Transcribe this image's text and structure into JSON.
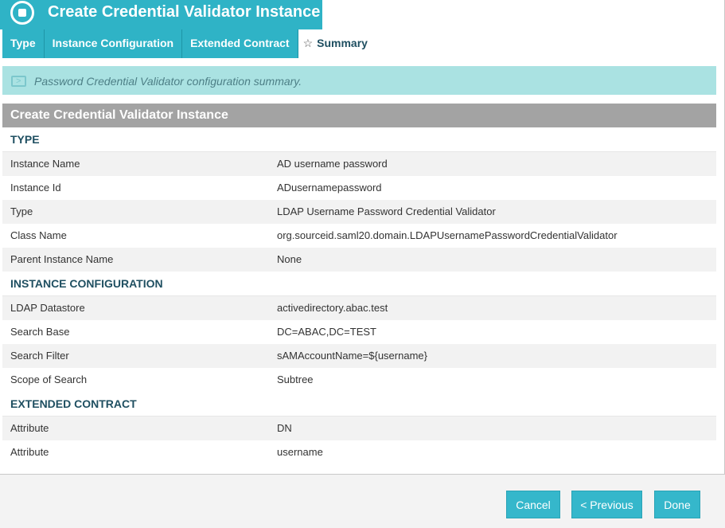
{
  "header": {
    "title": "Create Credential Validator Instance"
  },
  "tabs": [
    {
      "label": "Type"
    },
    {
      "label": "Instance Configuration"
    },
    {
      "label": "Extended Contract"
    },
    {
      "label": "Summary"
    }
  ],
  "info": {
    "text": "Password Credential Validator configuration summary."
  },
  "summary": {
    "title": "Create Credential Validator Instance",
    "type": {
      "title": "TYPE",
      "rows": [
        {
          "label": "Instance Name",
          "value": "AD username password"
        },
        {
          "label": "Instance Id",
          "value": "ADusernamepassword"
        },
        {
          "label": "Type",
          "value": "LDAP Username Password Credential Validator"
        },
        {
          "label": "Class Name",
          "value": "org.sourceid.saml20.domain.LDAPUsernamePasswordCredentialValidator"
        },
        {
          "label": "Parent Instance Name",
          "value": "None"
        }
      ]
    },
    "config": {
      "title": "INSTANCE CONFIGURATION",
      "rows": [
        {
          "label": "LDAP Datastore",
          "value": "activedirectory.abac.test"
        },
        {
          "label": "Search Base",
          "value": "DC=ABAC,DC=TEST"
        },
        {
          "label": "Search Filter",
          "value": "sAMAccountName=${username}"
        },
        {
          "label": "Scope of Search",
          "value": "Subtree"
        }
      ]
    },
    "contract": {
      "title": "EXTENDED CONTRACT",
      "rows": [
        {
          "label": "Attribute",
          "value": "DN"
        },
        {
          "label": "Attribute",
          "value": "username"
        }
      ]
    }
  },
  "buttons": {
    "cancel": "Cancel",
    "previous": "< Previous",
    "done": "Done"
  }
}
